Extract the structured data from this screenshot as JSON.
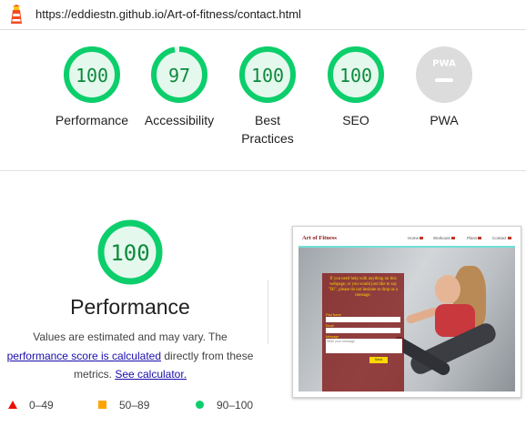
{
  "header": {
    "url": "https://eddiestn.github.io/Art-of-fitness/contact.html"
  },
  "colors": {
    "pass": "#0cce6b",
    "pass_text": "#0c8a3d",
    "pass_bg": "#e5f8ed",
    "average": "#ffa400",
    "fail": "#eb0f00",
    "neutral": "#dcdcdc"
  },
  "gauges": [
    {
      "label": "Performance",
      "score": "100",
      "fraction": 1.0
    },
    {
      "label": "Accessibility",
      "score": "97",
      "fraction": 0.97
    },
    {
      "label": "Best Practices",
      "score": "100",
      "fraction": 1.0
    },
    {
      "label": "SEO",
      "score": "100",
      "fraction": 1.0
    },
    {
      "label": "PWA",
      "score": "",
      "badge": "PWA"
    }
  ],
  "performance": {
    "score": "100",
    "title": "Performance",
    "desc_1": "Values are estimated and may vary. The",
    "link_1": "performance score is calculated",
    "desc_2": "directly from these",
    "desc_3": "metrics.",
    "link_2": "See calculator."
  },
  "thumbnail": {
    "brand": "Art of Fitness",
    "nav": [
      "Home",
      "Workouts",
      "Plans",
      "Contact"
    ],
    "form_text": "If you need help with anything on this webpage, or you would just like to say \"Hi\", please do not hesitate to drop us a message.",
    "fields": [
      "First Name",
      "Email",
      "Message"
    ],
    "textarea_placeholder": "Write your message",
    "submit": "Send"
  },
  "legend": [
    {
      "label": "0–49",
      "kind": "fail"
    },
    {
      "label": "50–89",
      "kind": "average"
    },
    {
      "label": "90–100",
      "kind": "pass"
    }
  ]
}
